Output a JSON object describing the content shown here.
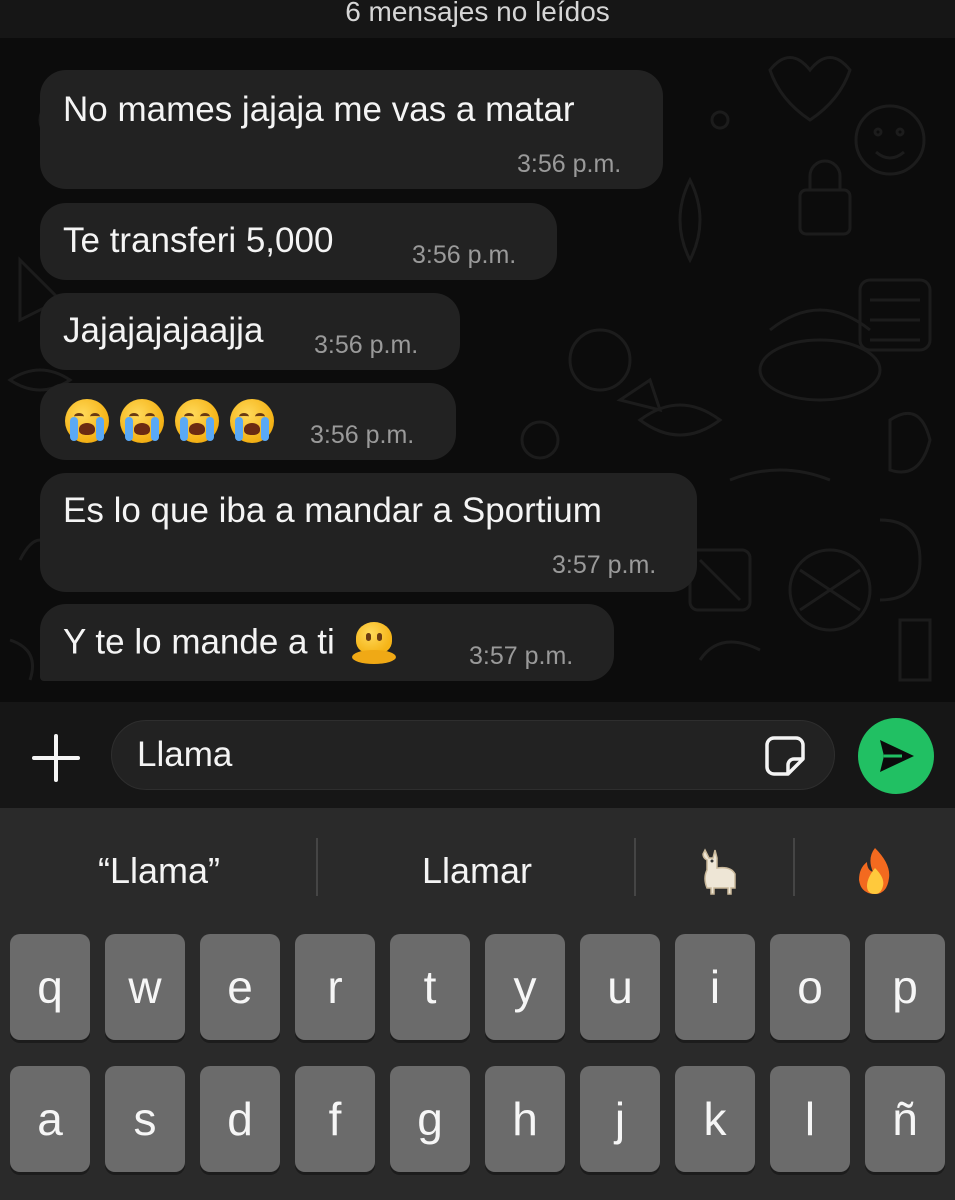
{
  "chat": {
    "unread_banner": "6 mensajes no leídos",
    "messages": [
      {
        "text": "No mames jajaja me vas a matar",
        "time": "3:56 p.m."
      },
      {
        "text": "Te transferi 5,000",
        "time": "3:56 p.m."
      },
      {
        "text": "Jajajajajaajja",
        "time": "3:56 p.m."
      },
      {
        "text": "😭😭😭😭",
        "emoji": [
          "loudly-crying-face",
          "loudly-crying-face",
          "loudly-crying-face",
          "loudly-crying-face"
        ],
        "time": "3:56 p.m."
      },
      {
        "text": "Es lo que iba a mandar a Sportium",
        "time": "3:57 p.m."
      },
      {
        "text": "Y te lo mande a ti",
        "emoji": [
          "melting-face"
        ],
        "time": "3:57 p.m."
      }
    ]
  },
  "composer": {
    "value": "Llama",
    "plus_icon": "plus-icon",
    "sticker_icon": "sticker-icon",
    "send_icon": "send-icon",
    "send_color": "#21c063"
  },
  "keyboard": {
    "suggestions": [
      {
        "label": "“Llama”"
      },
      {
        "label": "Llamar"
      },
      {
        "label": "🦙",
        "icon": "llama-emoji"
      },
      {
        "label": "🔥",
        "icon": "fire-emoji"
      }
    ],
    "row1": [
      "q",
      "w",
      "e",
      "r",
      "t",
      "y",
      "u",
      "i",
      "o",
      "p"
    ],
    "row2": [
      "a",
      "s",
      "d",
      "f",
      "g",
      "h",
      "j",
      "k",
      "l",
      "ñ"
    ]
  },
  "colors": {
    "bubble": "#222222",
    "background": "#0c0c0c",
    "keyboard": "#2a2a2a",
    "key": "#6b6b6b"
  }
}
